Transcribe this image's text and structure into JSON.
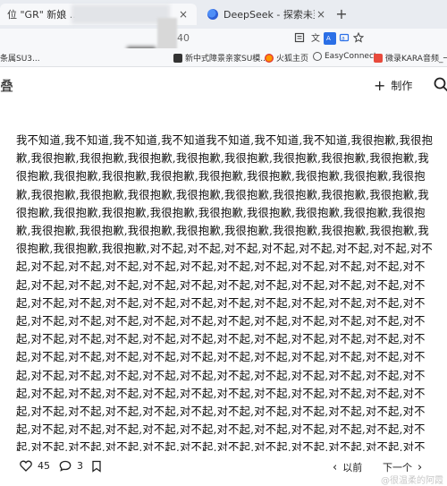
{
  "browser": {
    "tab1_title": "位 \"GR\" 新娘 ...",
    "tab2_title": "DeepSeek - 探索未至之境",
    "close_glyph": "×",
    "new_tab_glyph": "+",
    "address_fragment": "40",
    "toolbar_icons": [
      "reader-icon",
      "translate-icon",
      "extension-icon",
      "translate-blue-icon",
      "star-icon"
    ]
  },
  "bookmarks": [
    {
      "label": "条属SU3...",
      "icon": "folder-icon"
    },
    {
      "label": "新中式障景亲家SU模...",
      "icon": "bookmark-icon"
    },
    {
      "label": "火狐主页",
      "icon": "firefox-icon"
    },
    {
      "label": "EasyConnect",
      "icon": "globe-icon"
    },
    {
      "label": "微录KARA音频_一剑",
      "icon": "audio-icon"
    }
  ],
  "header": {
    "left_glyph": "叠",
    "make_label": "制作",
    "make_glyph": "+"
  },
  "content": {
    "text": "我不知道,我不知道,我不知道,我不知道我不知道,我不知道,我不知道,我很抱歉,我很抱歉,我很抱歉,我很抱歉,我很抱歉,我很抱歉,我很抱歉,我很抱歉,我很抱歉,我很抱歉,我很抱歉,我很抱歉,我很抱歉,我很抱歉,我很抱歉,我很抱歉,我很抱歉,我很抱歉,我很抱歉,我很抱歉,我很抱歉,我很抱歉,我很抱歉,我很抱歉,我很抱歉,我很抱歉,我很抱歉,我很抱歉,我很抱歉,我很抱歉,我很抱歉,我很抱歉,我很抱歉,我很抱歉,我很抱歉,我很抱歉,我很抱歉,我很抱歉,我很抱歉,我很抱歉,我很抱歉,我很抱歉,我很抱歉,我很抱歉,我很抱歉,我很抱歉,我很抱歉,对不起,对不起,对不起,对不起,对不起,对不起,对不起,对不起,对不起,对不起,对不起,对不起,对不起,对不起,对不起,对不起,对不起,对不起,对不起,对不起,对不起,对不起,对不起,对不起,对不起,对不起,对不起,对不起,对不起,对不起,对不起,对不起,对不起,对不起,对不起,对不起,对不起,对不起,对不起,对不起,对不起,对不起,对不起,对不起,对不起,对不起,对不起,对不起,对不起,对不起,对不起,对不起,对不起,对不起,对不起,对不起,对不起,对不起,对不起,对不起,对不起,对不起,对不起,对不起,对不起,对不起,对不起,对不起,对不起,对不起,对不起,对不起,对不起,对不起,对不起,对不起,对不起,对不起,对不起,对不起,对不起,对不起,对不起,对不起,对不起,对不起,对不起,对不起,对不起,对不起,对不起,对不起,对不起,对不起,对不起,对不起,对不起,对不起,对不起,对不起,对不起,对不起,对不起,对不起,对不起,对不起,对不起,对不起,对不起,对不起,对不起,对不起,对不起,对不起,对不起,对不起,对不起,对不起,对不起,对不起,对不起,对不起,对不起,对不起,对不起,对不起,对不起,对不起,对不起,对不起,对不起,对不起,对不起,对不起,对不起,对不起,对不起,对不起,对不起,对不起,对不起,对不起,对不起,对不起,对不起,对不起,对不起,对不起,对不起,对不起,对不起,对不起,对不起,对不起,对不起,对不起,对不起,对不起,对不起,对不起,对不起,对不起,对不起,对不起,对不起,对不起,对不起,对不起,对不起,对不起,对不起,对不起,对不起,对不起,对不起,对不起,对不起,对不起,对不起,对不起,对不起,对不起,对不起,对不起,对不起,对不起,对不起,对不起,对不起,对不起,对不起,对不起,对不起,对不起,对不起,对不起,对不起,对不起,对不起,对不起,对不起,对不起,对不起,对不起,对不起,对不起,对不起,对不起,对不起,对不起,对不起,对不起,对不起,对不起,对不起,对不起,对不起,"
  },
  "footer": {
    "likes": "45",
    "comments": "3",
    "prev_label": "以前",
    "next_label": "下一个",
    "prev_glyph": "‹",
    "next_glyph": "›",
    "watermark": "@很温柔的阿霞"
  }
}
